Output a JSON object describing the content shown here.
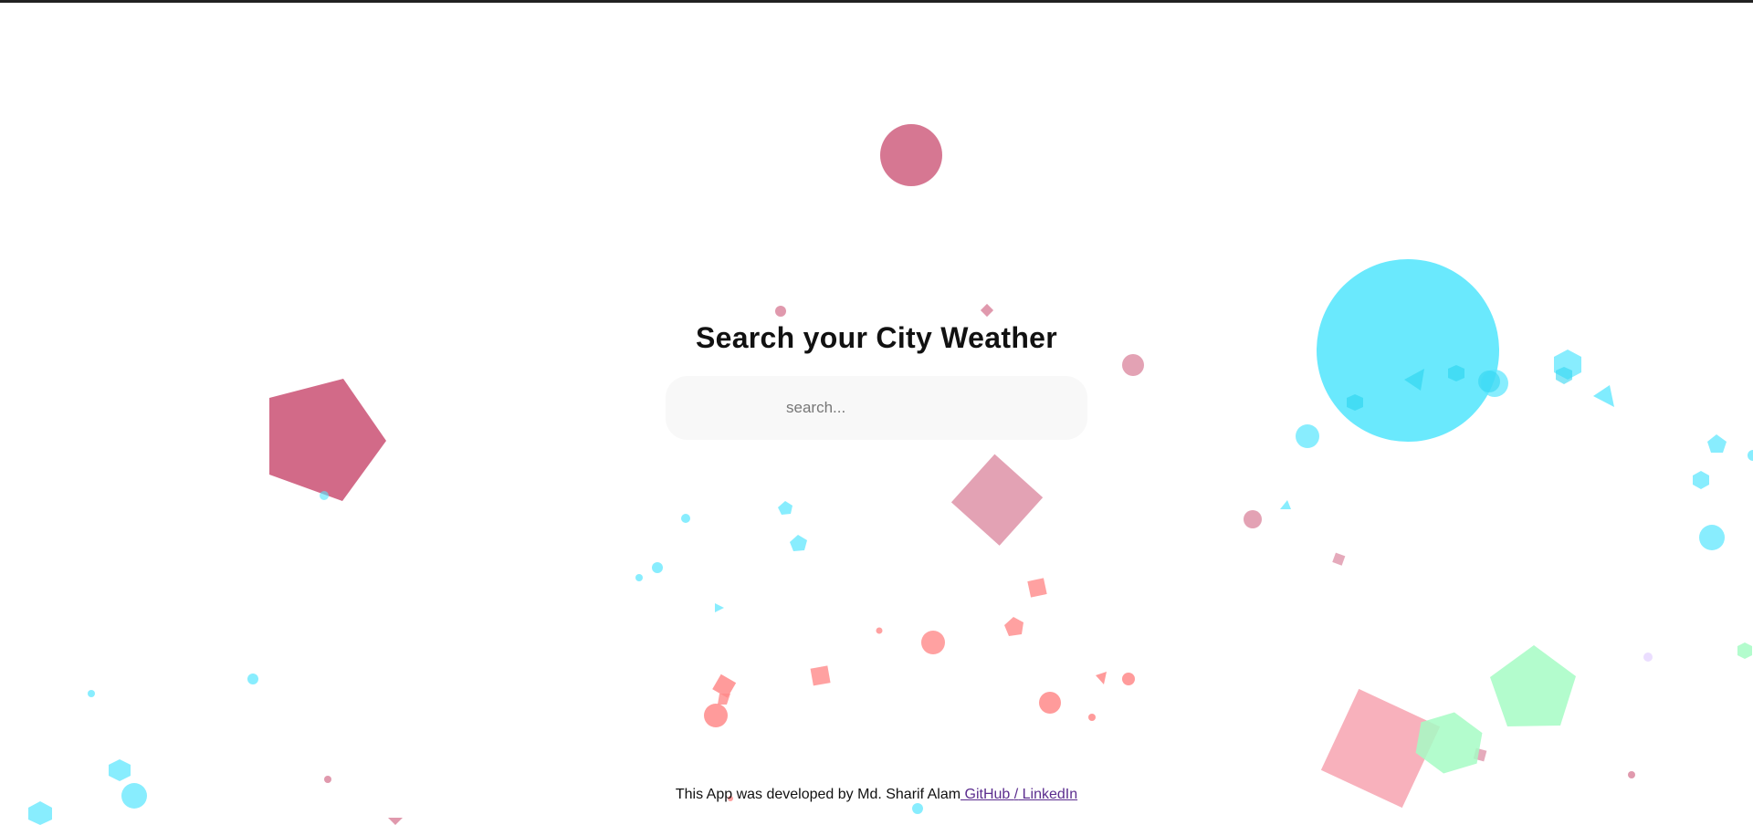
{
  "main": {
    "title": "Search your City Weather",
    "search_placeholder": "search..."
  },
  "footer": {
    "text": "This App was developed by Md. Sharif Alam",
    "github_label": " GitHub ",
    "separator": "/",
    "linkedin_label": " LinkedIn"
  },
  "colors": {
    "crimson": "#cc5577",
    "pink": "#e094a8",
    "salmon": "#ff8a8a",
    "cyan": "#55e6fd",
    "green": "#a6fcc4",
    "rose": "#f7a3b0",
    "link": "#5b2d8e"
  }
}
